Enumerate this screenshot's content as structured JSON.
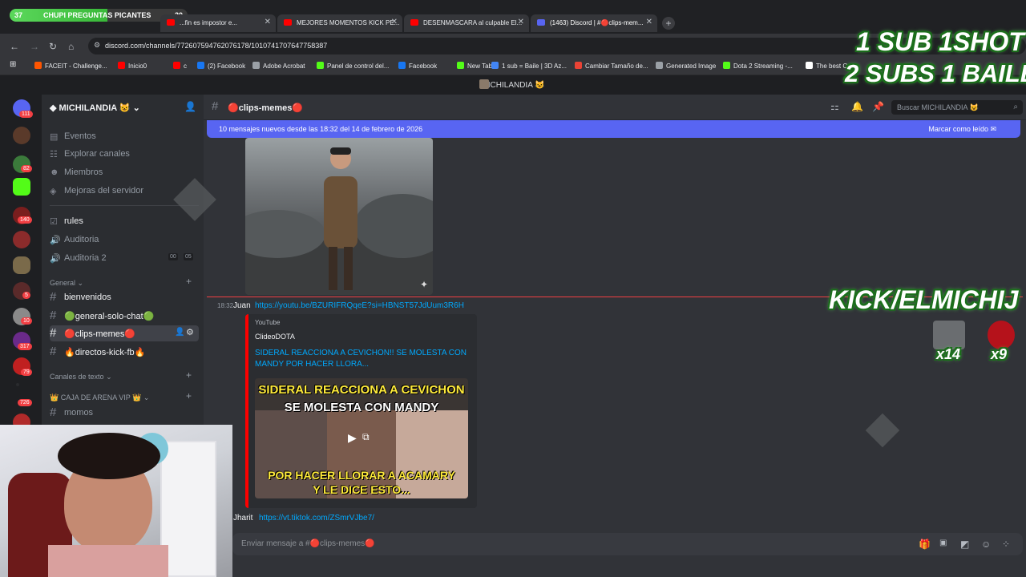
{
  "browser": {
    "progress": {
      "left": "37",
      "label": "CHUPI PREGUNTAS PICANTES",
      "right": "30",
      "fraction": 0.55
    },
    "tabs": [
      {
        "title": "...fin es impostor e..."
      },
      {
        "title": "MEJORES MOMENTOS KICK PE..."
      },
      {
        "title": "DESENMASCARA al culpable El..."
      },
      {
        "title": "(1463) Discord | #🔴clips-mem..."
      }
    ],
    "url": "discord.com/channels/772607594762076178/1010741707647758387",
    "bookmarks": [
      {
        "label": "FACEIT - Challenge...",
        "color": "#ff5500"
      },
      {
        "label": "Inicio0",
        "color": "#ff0000"
      },
      {
        "label": "c",
        "color": "#ff0000"
      },
      {
        "label": "(2) Facebook",
        "color": "#1877f2"
      },
      {
        "label": "Adobe Acrobat",
        "color": "#9aa0a6"
      },
      {
        "label": "Panel de control del...",
        "color": "#53fc18"
      },
      {
        "label": "Facebook",
        "color": "#1877f2"
      },
      {
        "label": "New Tab",
        "color": "#53fc18"
      },
      {
        "label": "1 sub = Baile | 3D Az...",
        "color": "#4285f4"
      },
      {
        "label": "Cambiar Tamaño de...",
        "color": "#ea4335"
      },
      {
        "label": "Generated Image",
        "color": "#9aa0a6"
      },
      {
        "label": "Dota 2 Streaming -...",
        "color": "#53fc18"
      },
      {
        "label": "The best C...",
        "color": "#ffffff"
      }
    ]
  },
  "discord": {
    "window_title": "MICHILANDIA 😺",
    "server_name": "MICHILANDIA 😺",
    "server_badges": [
      "111",
      "82",
      "140",
      "5",
      "10",
      "317",
      "79",
      "726"
    ],
    "nav_items": [
      "Eventos",
      "Explorar canales",
      "Miembros",
      "Mejoras del servidor"
    ],
    "channels_top": [
      "rules",
      "Auditoria",
      "Auditoria 2"
    ],
    "voice_counts": {
      "a": "00",
      "b": "05"
    },
    "category_general": "General",
    "general_channels": [
      "bienvenidos",
      "🟢general-solo-chat🟢",
      "🔴clips-memes🔴",
      "🔥directos-kick-fb🔥"
    ],
    "category_text": "Canales de texto",
    "category_vip": "👑 CAJA DE ARENA VIP 👑",
    "vip_channels": [
      "momos"
    ],
    "channel_header": "🔴clips-memes🔴",
    "search_placeholder": "Buscar MICHILANDIA 😺",
    "new_messages": "10 mensajes nuevos desde las 18:32 del 14 de febrero de 2026",
    "mark_read": "Marcar como leído",
    "message1": {
      "time": "18:32",
      "author": "Juan",
      "link": "https://youtu.be/BZURIFRQqeE?si=HBNST57JdUum3R6H",
      "embed": {
        "provider": "YouTube",
        "channel": "ClideoDOTA",
        "title": "SIDERAL REACCIONA A CEVICHON!! SE MOLESTA CON MANDY POR HACER LLORA...",
        "thumb_top1": "SIDERAL REACCIONA A CEVICHON",
        "thumb_top2": "SE MOLESTA CON MANDY",
        "thumb_bottom1": "POR HACER LLORAR A ACAMARY",
        "thumb_bottom2": "Y LE DICE ESTO..."
      }
    },
    "message2": {
      "author": "Jharit",
      "link": "https://vt.tiktok.com/ZSmrVJbe7/"
    },
    "input_placeholder": "Enviar mensaje a #🔴clips-memes🔴"
  },
  "overlay": {
    "line1": "1 SUB  1SHOT",
    "line2": "2 SUBS 1 BAILE",
    "kick": "KICK/ELMICHIJ",
    "count1": "x14",
    "count2": "x9"
  }
}
